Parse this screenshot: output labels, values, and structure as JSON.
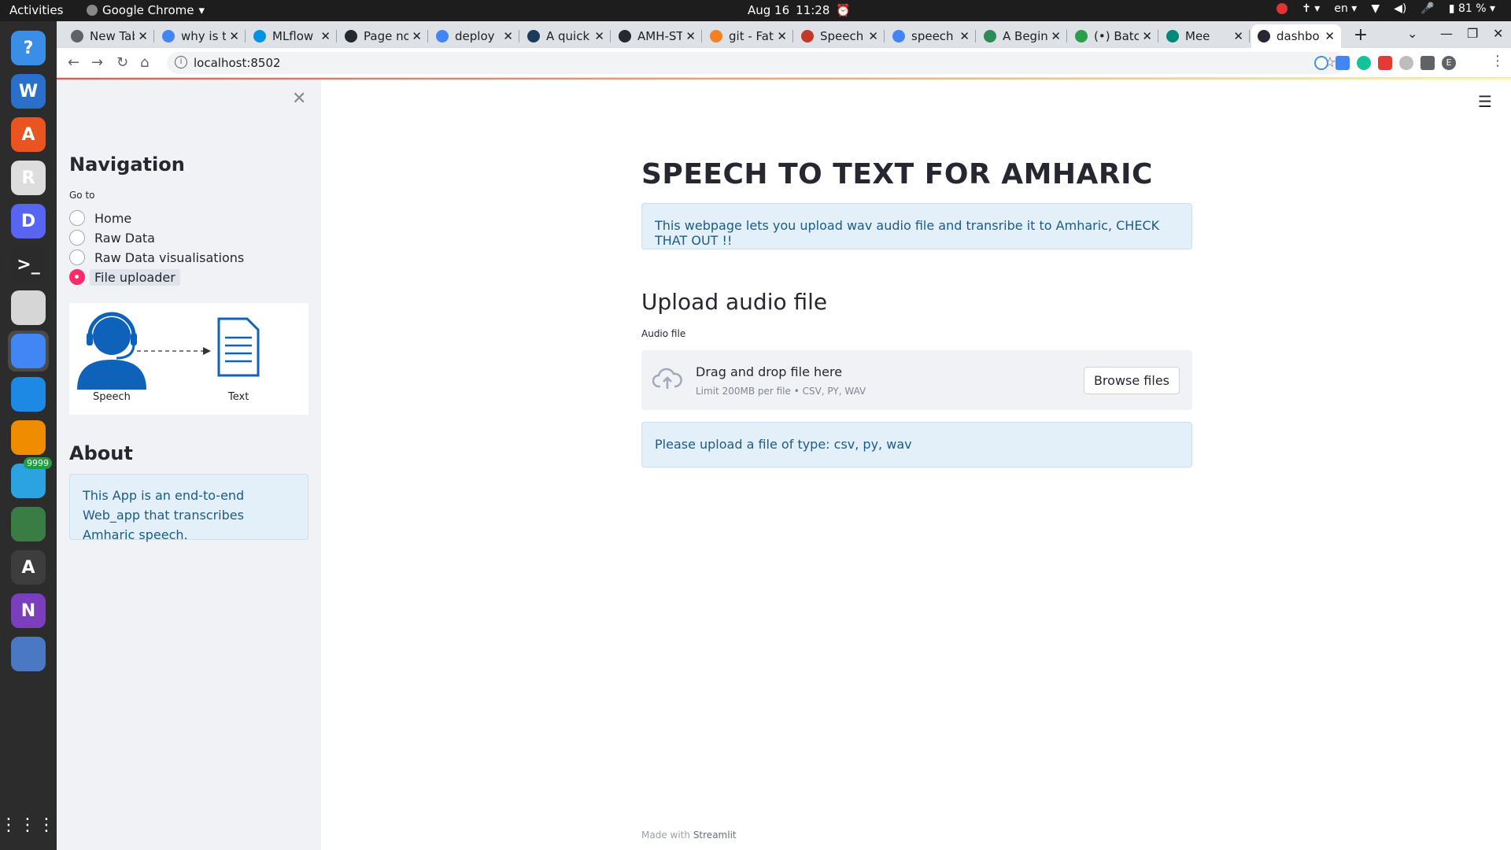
{
  "topbar": {
    "activities": "Activities",
    "app_name": "Google Chrome",
    "date": "Aug 16",
    "time": "11:28",
    "language": "en",
    "battery": "81 %"
  },
  "dock": {
    "items": [
      {
        "name": "help",
        "glyph": "?",
        "color": "#3a8ee6"
      },
      {
        "name": "libreoffice-writer",
        "glyph": "W",
        "color": "#2a6fc9"
      },
      {
        "name": "ubuntu-software",
        "glyph": "A",
        "color": "#e95420"
      },
      {
        "name": "document-viewer",
        "glyph": "R",
        "color": "#dddddd"
      },
      {
        "name": "discord",
        "glyph": "D",
        "color": "#5865f2"
      },
      {
        "name": "terminal",
        "glyph": ">_",
        "color": "#2b2b2b"
      },
      {
        "name": "files",
        "glyph": "",
        "color": "#d6d6d6"
      },
      {
        "name": "chrome",
        "glyph": "",
        "color": "#4285f4"
      },
      {
        "name": "vscode",
        "glyph": "",
        "color": "#1e88e5"
      },
      {
        "name": "vlc",
        "glyph": "",
        "color": "#f08c00"
      },
      {
        "name": "telegram",
        "glyph": "",
        "color": "#2aa3e0",
        "badge": "9999"
      },
      {
        "name": "camera",
        "glyph": "",
        "color": "#3a7d44"
      },
      {
        "name": "software-updater",
        "glyph": "A",
        "color": "#3d3d3d"
      },
      {
        "name": "onenote",
        "glyph": "N",
        "color": "#7b3fbd"
      },
      {
        "name": "drive",
        "glyph": "",
        "color": "#4a78c2"
      }
    ],
    "show_apps_label": "Show Applications"
  },
  "tabs": [
    {
      "title": "New Tab",
      "fav": "#5f6368"
    },
    {
      "title": "why is t",
      "fav": "#4285f4"
    },
    {
      "title": "MLflow",
      "fav": "#0194e2"
    },
    {
      "title": "Page no",
      "fav": "#24292f"
    },
    {
      "title": "deploy",
      "fav": "#4285f4"
    },
    {
      "title": "A quick",
      "fav": "#1b3a5c"
    },
    {
      "title": "AMH-ST",
      "fav": "#24292f"
    },
    {
      "title": "git - Fat",
      "fav": "#f48024"
    },
    {
      "title": "Speech",
      "fav": "#c0392b"
    },
    {
      "title": "speech",
      "fav": "#4285f4"
    },
    {
      "title": "A Begin",
      "fav": "#2e8b57"
    },
    {
      "title": "(•) Batc",
      "fav": "#2c9e4b"
    },
    {
      "title": "Mee",
      "fav": "#00897b"
    },
    {
      "title": "dashbo",
      "fav": "#262730",
      "active": true
    }
  ],
  "address": {
    "url": "localhost:8502"
  },
  "sidebar": {
    "nav_title": "Navigation",
    "goto_label": "Go to",
    "options": [
      "Home",
      "Raw Data",
      "Raw Data visualisations",
      "File uploader"
    ],
    "selected": "File uploader",
    "illustration": {
      "speech_caption": "Speech",
      "text_caption": "Text"
    },
    "about_title": "About",
    "about_text": "This App is an end-to-end Web_app that transcribes Amharic speech."
  },
  "main": {
    "title": "SPEECH TO TEXT FOR AMHARIC",
    "intro": "This webpage lets you upload wav audio file and transribe it to Amharic, CHECK THAT OUT !!",
    "upload_heading": "Upload audio file",
    "uploader_label": "Audio file",
    "drop_text": "Drag and drop file here",
    "limit_text": "Limit 200MB per file • CSV, PY, WAV",
    "browse_label": "Browse files",
    "upload_prompt": "Please upload a file of type: csv, py, wav"
  },
  "footer": {
    "made_with": "Made with",
    "brand": "Streamlit"
  },
  "colors": {
    "accent": "#ff2b6a",
    "info_bg": "#e3f0f9",
    "info_text": "#1a5b8a",
    "sidebar_bg": "#f0f2f6"
  }
}
